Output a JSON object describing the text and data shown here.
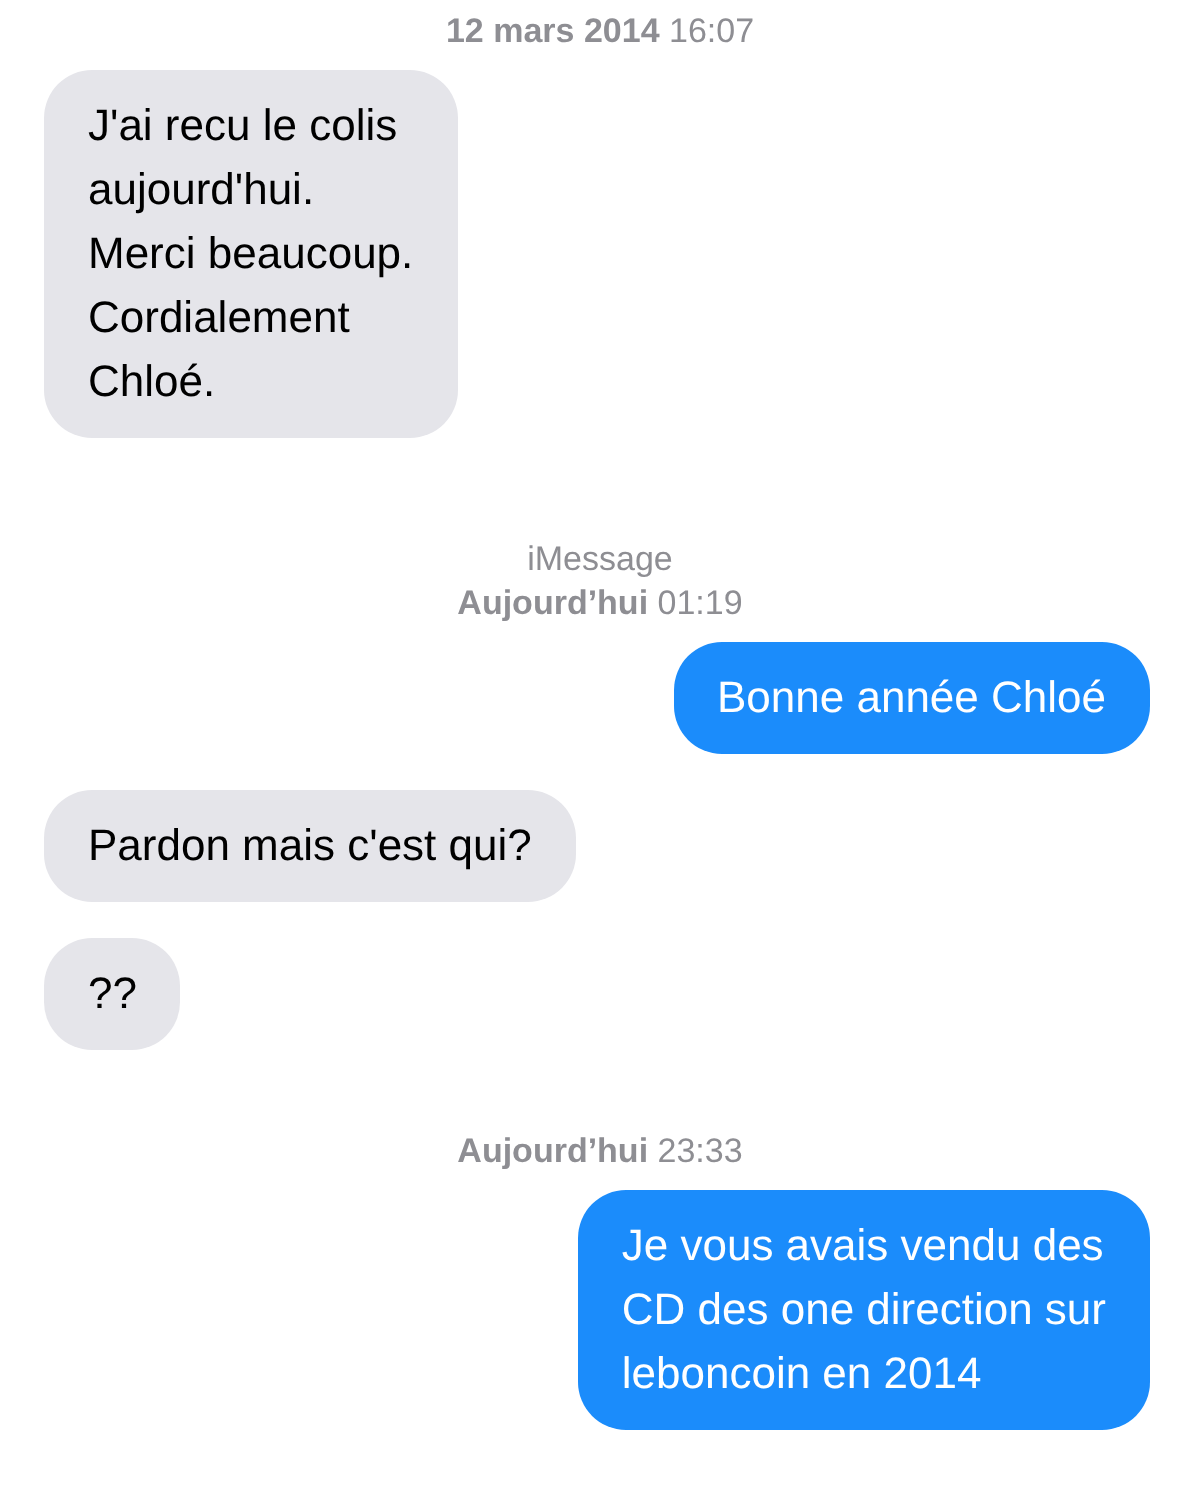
{
  "conversation": [
    {
      "kind": "timestamp",
      "text": "**12 mars 2014** 16:07"
    },
    {
      "kind": "received",
      "text": "J'ai recu le colis\naujourd'hui.\nMerci beaucoup.\nCordialement\nChloé."
    },
    {
      "kind": "timestamp",
      "service": "iMessage",
      "text": "**Aujourd’hui** 01:19"
    },
    {
      "kind": "sent",
      "text": "Bonne année Chloé"
    },
    {
      "kind": "received",
      "text": "Pardon mais c'est qui?"
    },
    {
      "kind": "received",
      "text": "??"
    },
    {
      "kind": "timestamp",
      "text": "**Aujourd’hui** 23:33"
    },
    {
      "kind": "sent",
      "text": "Je vous avais vendu des\nCD des one direction sur\nleboncoin en 2014"
    }
  ]
}
